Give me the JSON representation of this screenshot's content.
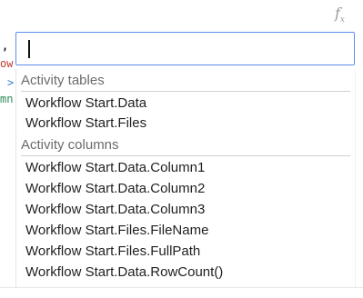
{
  "toolbar": {
    "fx_icon": "function-icon",
    "fx_main": "f",
    "fx_sub": "x"
  },
  "editor_fragments": {
    "comma": ",",
    "ow": "ow",
    "arrow": ">",
    "mn": "mn"
  },
  "search": {
    "value": "",
    "placeholder": ""
  },
  "dropdown": {
    "groups": [
      {
        "header": "Activity tables",
        "items": [
          "Workflow Start.Data",
          "Workflow Start.Files"
        ]
      },
      {
        "header": "Activity columns",
        "items": [
          "Workflow Start.Data.Column1",
          "Workflow Start.Data.Column2",
          "Workflow Start.Data.Column3",
          "Workflow Start.Files.FileName",
          "Workflow Start.Files.FullPath",
          "Workflow Start.Data.RowCount()"
        ]
      }
    ]
  },
  "colors": {
    "accent_border": "#5b8def",
    "header_text": "#6b6b6b",
    "item_text": "#1f1f1f"
  }
}
